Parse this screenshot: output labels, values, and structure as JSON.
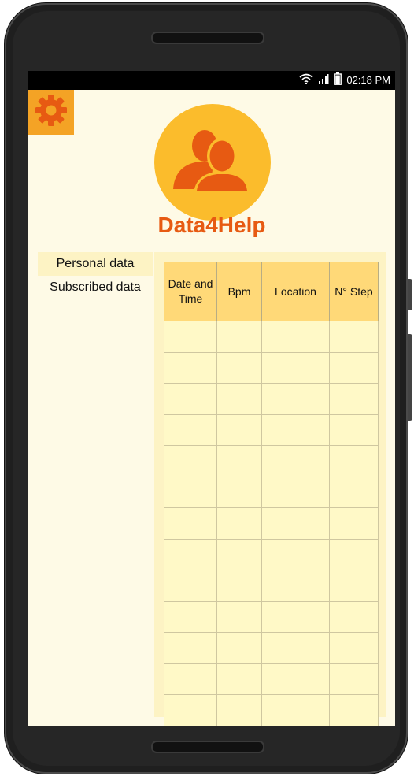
{
  "status_bar": {
    "time": "02:18 PM",
    "icons": [
      "wifi-icon",
      "signal-icon",
      "battery-icon"
    ]
  },
  "header": {
    "settings_icon": "gear-icon",
    "avatar_icon": "users-icon",
    "app_title": "Data4Help"
  },
  "menu": {
    "items": [
      {
        "label": "Personal data",
        "active": true
      },
      {
        "label": "Subscribed data",
        "active": false
      }
    ]
  },
  "table": {
    "columns": [
      {
        "label": "Date and Time"
      },
      {
        "label": "Bpm"
      },
      {
        "label": "Location"
      },
      {
        "label": "N° Step"
      }
    ],
    "rows": [
      [
        "",
        "",
        "",
        ""
      ],
      [
        "",
        "",
        "",
        ""
      ],
      [
        "",
        "",
        "",
        ""
      ],
      [
        "",
        "",
        "",
        ""
      ],
      [
        "",
        "",
        "",
        ""
      ],
      [
        "",
        "",
        "",
        ""
      ],
      [
        "",
        "",
        "",
        ""
      ],
      [
        "",
        "",
        "",
        ""
      ],
      [
        "",
        "",
        "",
        ""
      ],
      [
        "",
        "",
        "",
        ""
      ],
      [
        "",
        "",
        "",
        ""
      ],
      [
        "",
        "",
        "",
        ""
      ],
      [
        "",
        "",
        "",
        ""
      ]
    ]
  },
  "colors": {
    "accent": "#e75a12",
    "settings_bg": "#f4a325",
    "avatar_bg": "#fbbc2c",
    "header_cell": "#ffd978",
    "body_cell": "#fff9c7",
    "screen_bg": "#fefae6"
  }
}
